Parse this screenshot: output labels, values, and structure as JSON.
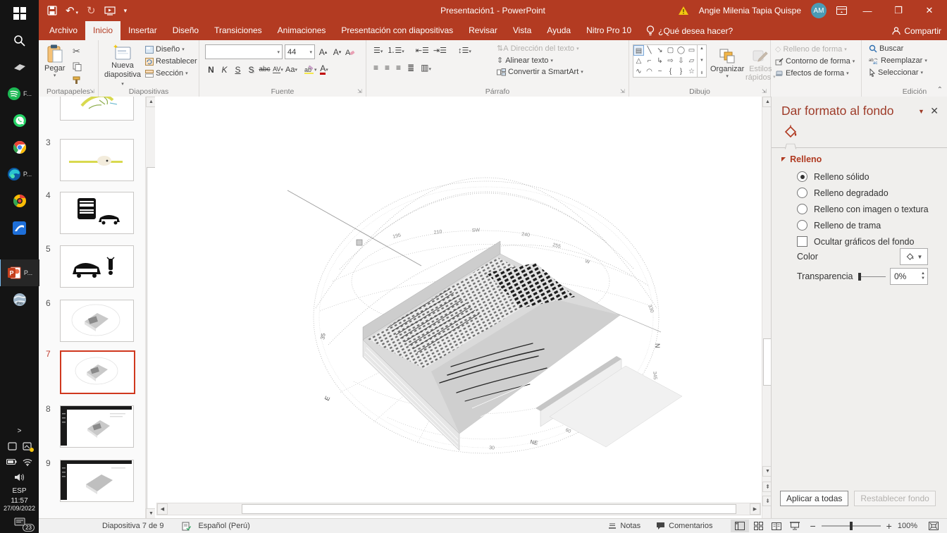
{
  "taskbar": {
    "time": "11:57",
    "date": "27/09/2022",
    "language": "ESP",
    "notification_count": "23",
    "tray_expand": ">",
    "labels": {
      "spotify": "F...",
      "edge": "P...",
      "powerpoint": "P..."
    }
  },
  "titlebar": {
    "title": "Presentación1  -  PowerPoint",
    "user": "Angie Milenia Tapia Quispe",
    "initials": "AM"
  },
  "tabs": {
    "archivo": "Archivo",
    "inicio": "Inicio",
    "insertar": "Insertar",
    "diseno": "Diseño",
    "transiciones": "Transiciones",
    "animaciones": "Animaciones",
    "presentacion": "Presentación con diapositivas",
    "revisar": "Revisar",
    "vista": "Vista",
    "ayuda": "Ayuda",
    "nitro": "Nitro Pro 10",
    "tellme": "¿Qué desea hacer?",
    "compartir": "Compartir"
  },
  "ribbon": {
    "clipboard": {
      "paste": "Pegar",
      "label": "Portapapeles"
    },
    "slides": {
      "new1": "Nueva",
      "new2": "diapositiva",
      "design": "Diseño",
      "reset": "Restablecer",
      "section": "Sección",
      "label": "Diapositivas"
    },
    "font": {
      "size": "44",
      "bold": "N",
      "italic": "K",
      "underline": "S",
      "shadow": "S",
      "strike": "abc",
      "spacing": "AV",
      "case": "Aa",
      "color": "A",
      "label": "Fuente"
    },
    "paragraph": {
      "text_direction": "Dirección del texto",
      "align_text": "Alinear texto",
      "smartart": "Convertir a SmartArt",
      "label": "Párrafo"
    },
    "drawing": {
      "arrange": "Organizar",
      "quick1": "Estilos",
      "quick2": "rápidos",
      "fill": "Relleno de forma",
      "outline": "Contorno de forma",
      "effects": "Efectos de forma",
      "label": "Dibujo"
    },
    "editing": {
      "find": "Buscar",
      "replace": "Reemplazar",
      "select": "Seleccionar",
      "label": "Edición"
    }
  },
  "thumbnails": {
    "numbers": [
      "3",
      "4",
      "5",
      "6",
      "7",
      "8",
      "9"
    ],
    "selected": "7"
  },
  "diagram": {
    "labels": [
      {
        "text": "SW"
      },
      {
        "text": "195"
      },
      {
        "text": "210"
      },
      {
        "text": "240"
      },
      {
        "text": "255"
      },
      {
        "text": "W"
      },
      {
        "text": "N"
      },
      {
        "text": "NE"
      },
      {
        "text": "E"
      },
      {
        "text": "35"
      },
      {
        "text": "30"
      },
      {
        "text": "60"
      },
      {
        "text": "330"
      },
      {
        "text": "345"
      }
    ]
  },
  "panel": {
    "title": "Dar formato al fondo",
    "section": "Relleno",
    "opt_solid": "Relleno sólido",
    "opt_gradient": "Relleno degradado",
    "opt_picture": "Relleno con imagen o textura",
    "opt_pattern": "Relleno de trama",
    "hide_graphics": "Ocultar gráficos del fondo",
    "color": "Color",
    "transparency": "Transparencia",
    "transparency_value": "0%",
    "apply_all": "Aplicar a todas",
    "reset": "Restablecer fondo"
  },
  "statusbar": {
    "slide": "Diapositiva 7 de 9",
    "language": "Español (Perú)",
    "notes": "Notas",
    "comments": "Comentarios",
    "zoom": "100%"
  },
  "icons": {
    "start-icon": "windows logo",
    "search-icon": "magnifier",
    "spotify-icon": "green circle",
    "whatsapp-icon": "green phone",
    "chrome-icon": "colored circle",
    "edge-icon": "blue swirl",
    "powerpoint-icon": "P tile",
    "google-earth-icon": "globe",
    "warning-icon": "yellow triangle",
    "save-icon": "floppy",
    "undo-icon": "↶",
    "redo-icon": "↻",
    "bucket-icon": "paint bucket",
    "close-icon": "✕",
    "minimize-icon": "—",
    "restore-icon": "❐",
    "lightbulb-icon": "bulb"
  },
  "colors": {
    "titlebar": "#b33b22",
    "accent_red": "#c23a23",
    "selection": "#d0381e"
  }
}
